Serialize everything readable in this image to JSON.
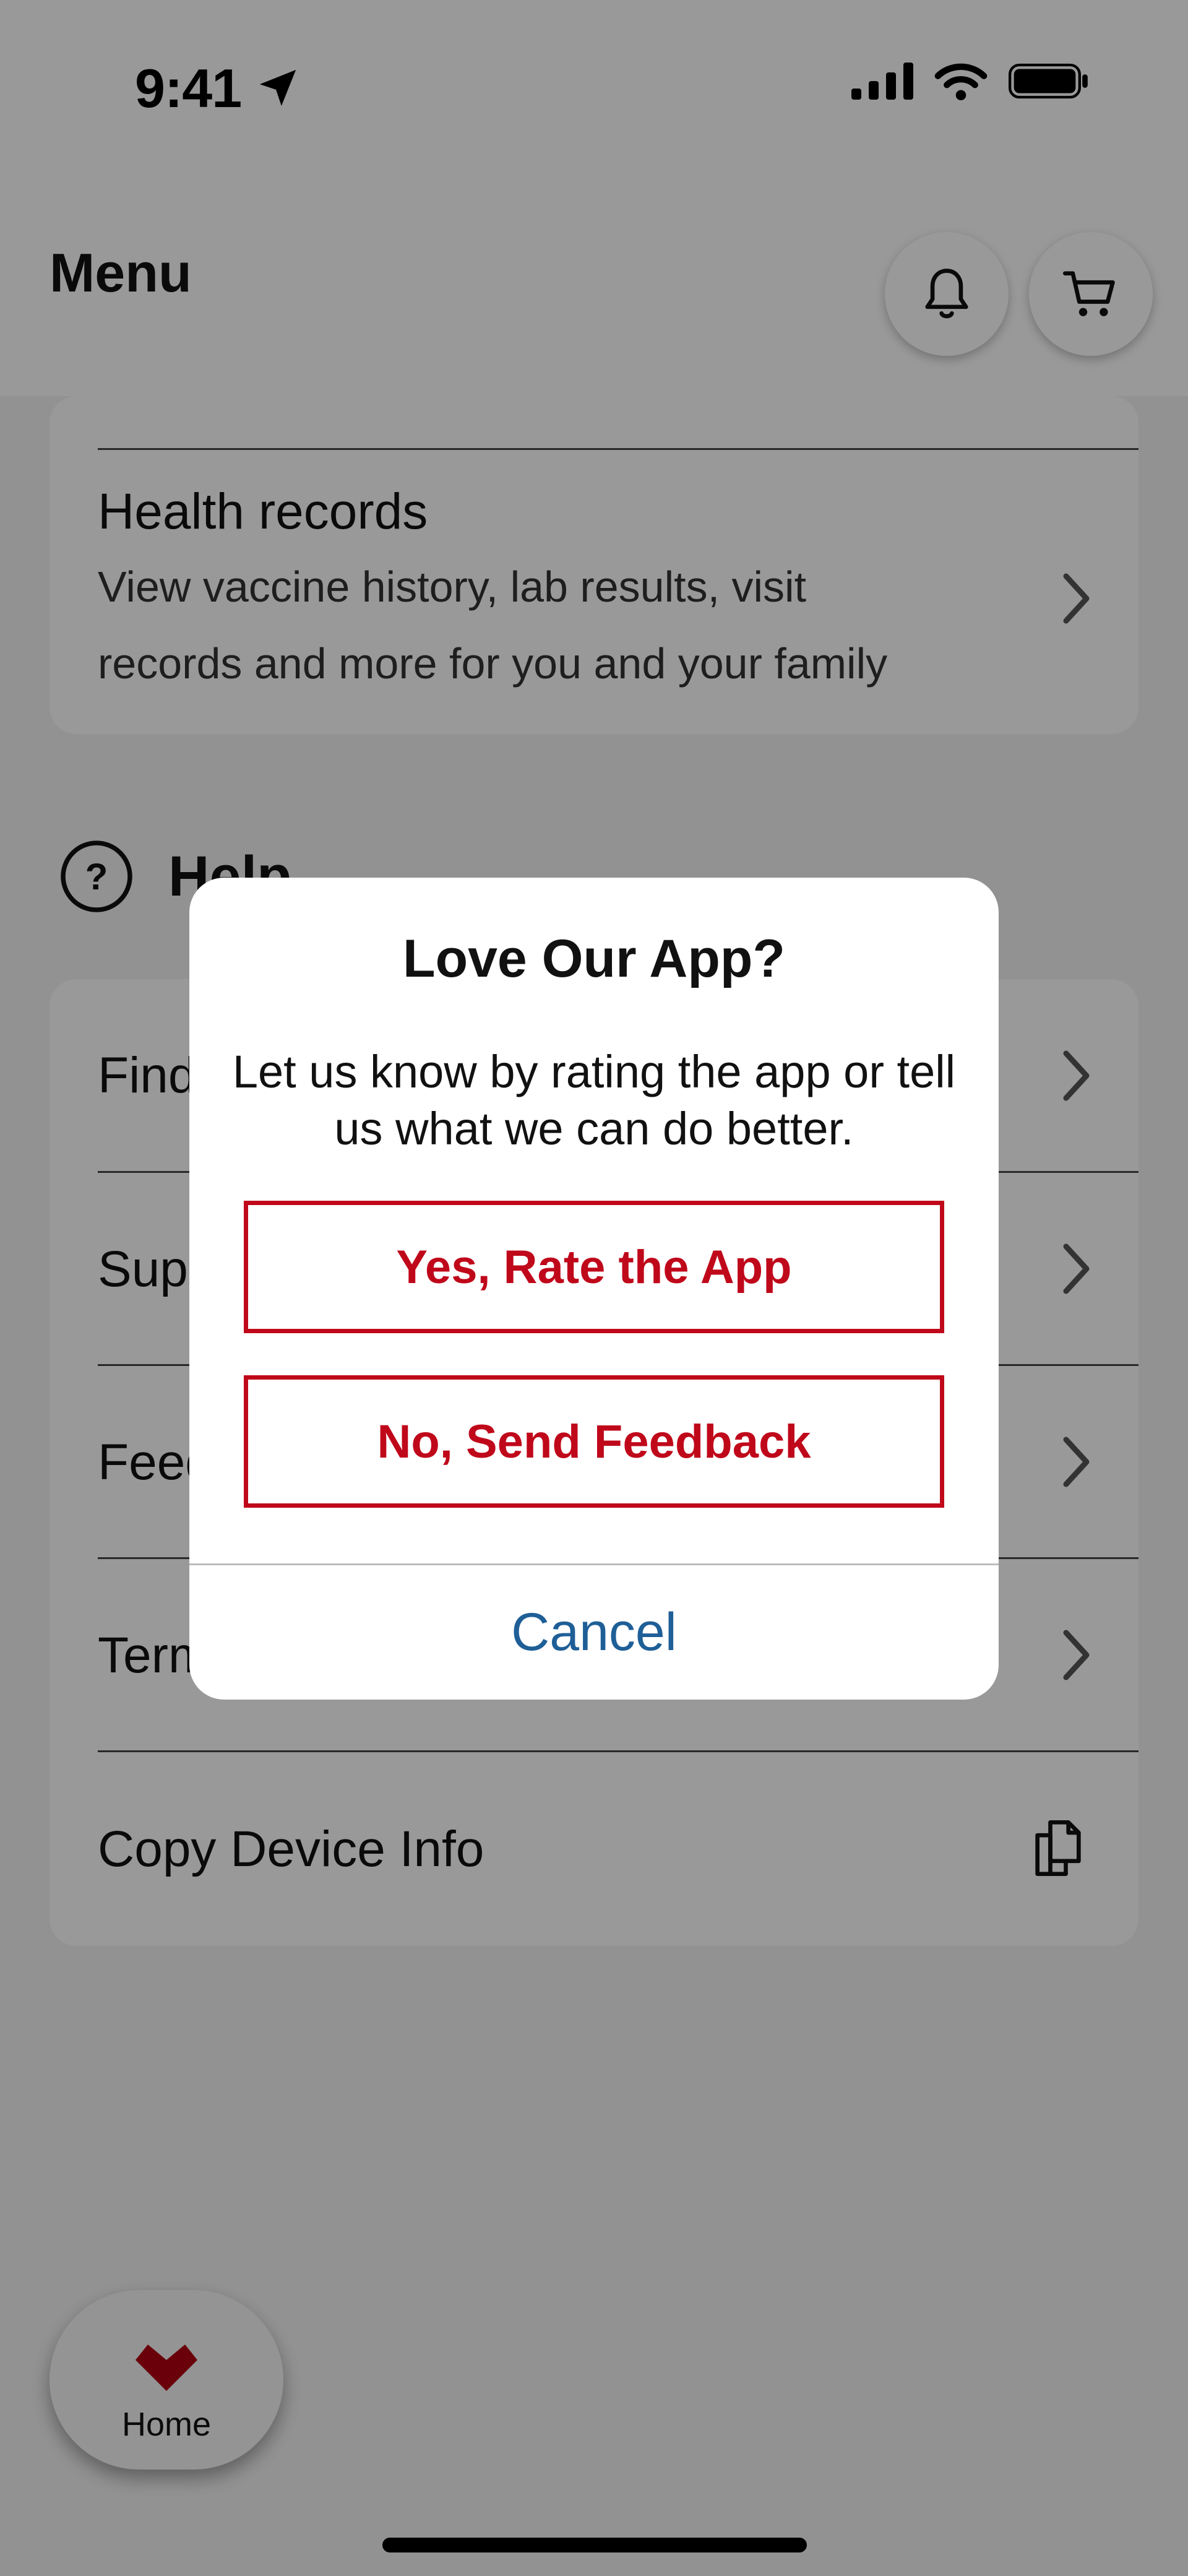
{
  "status_bar": {
    "time": "9:41"
  },
  "header": {
    "title": "Menu"
  },
  "health_records": {
    "title": "Health records",
    "subtitle_line1": "View vaccine history, lab results, visit",
    "subtitle_line2": "records and more for you and your family"
  },
  "help": {
    "title": "Help",
    "items": [
      {
        "label": "Find"
      },
      {
        "label": "Sup"
      },
      {
        "label": "Feed"
      },
      {
        "label": "Term"
      },
      {
        "label": "Copy Device Info"
      }
    ]
  },
  "bottom_nav": {
    "home_label": "Home"
  },
  "dialog": {
    "title": "Love Our App?",
    "message": "Let us know by rating the app or tell us what we can do better.",
    "rate_button": "Yes, Rate the App",
    "feedback_button": "No, Send Feedback",
    "cancel_button": "Cancel"
  },
  "icons": {
    "bell": "bell-icon",
    "cart": "cart-icon",
    "help": "question-circle-icon",
    "chevron": "chevron-right-icon",
    "copy": "copy-icon",
    "home": "heart-icon"
  },
  "colors": {
    "accent": "#c0081b",
    "link": "#1f5f97"
  }
}
